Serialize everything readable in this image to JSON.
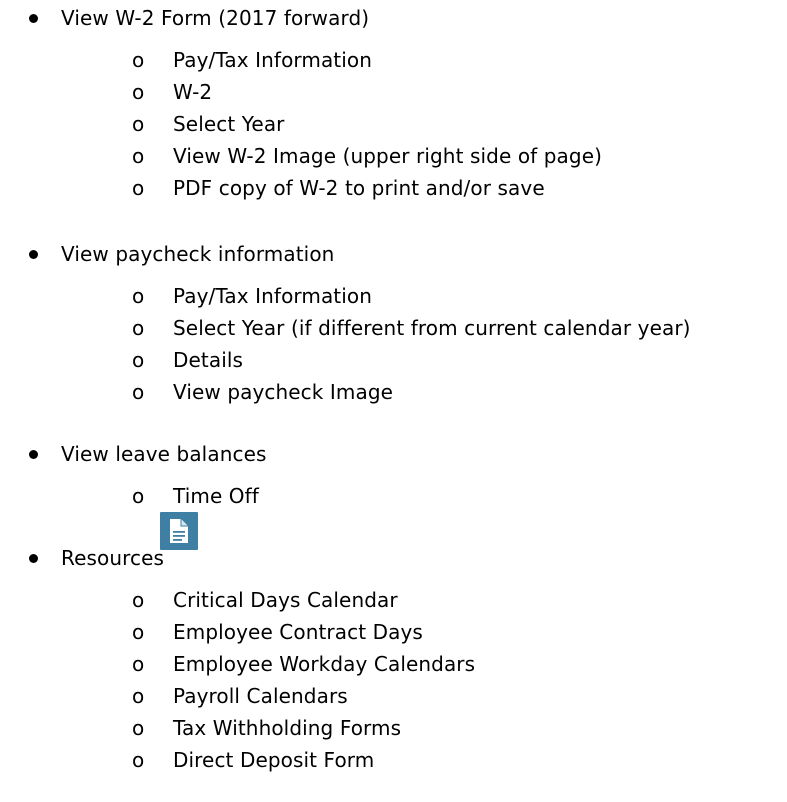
{
  "sections": [
    {
      "label": "View W-2 Form (2017 forward)",
      "items": [
        "Pay/Tax Information",
        "W-2",
        "Select Year",
        "View W-2 Image (upper right side of page)",
        "PDF copy of W-2 to print and/or save"
      ]
    },
    {
      "label": "View paycheck information",
      "items": [
        "Pay/Tax Information",
        "Select Year (if different from current calendar year)",
        "Details",
        "View paycheck Image"
      ]
    },
    {
      "label": "View leave balances",
      "items": [
        "Time Off"
      ]
    },
    {
      "label": "Resources",
      "icon": "document-icon",
      "items": [
        "Critical Days Calendar",
        "Employee Contract Days",
        "Employee Workday Calendars",
        "Payroll Calendars",
        "Tax Withholding Forms",
        "Direct Deposit Form"
      ]
    }
  ],
  "markers": {
    "level1": "•",
    "level2": "o"
  },
  "colors": {
    "text": "#000000",
    "icon_background": "#3f7fa3",
    "icon_glyph": "#ffffff"
  }
}
